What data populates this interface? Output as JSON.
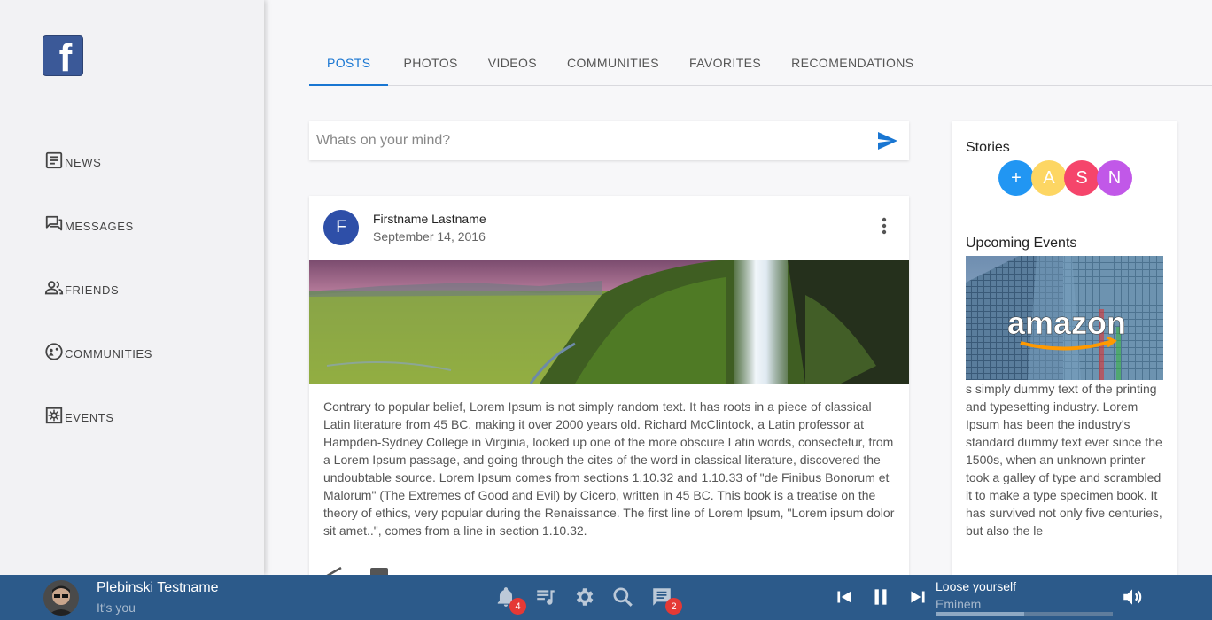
{
  "sidebar": {
    "logo": "f",
    "items": [
      {
        "label": "NEWS",
        "icon": "news-icon"
      },
      {
        "label": "MESSAGES",
        "icon": "messages-icon"
      },
      {
        "label": "FRIENDS",
        "icon": "friends-icon"
      },
      {
        "label": "COMMUNITIES",
        "icon": "communities-icon"
      },
      {
        "label": "EVENTS",
        "icon": "events-icon"
      }
    ]
  },
  "tabs": [
    "POSTS",
    "PHOTOS",
    "VIDEOS",
    "COMMUNITIES",
    "FAVORITES",
    "RECOMENDATIONS"
  ],
  "composer": {
    "placeholder": "Whats on your mind?"
  },
  "post": {
    "avatar_letter": "F",
    "author": "Firstname Lastname",
    "date": "September 14, 2016",
    "text": "Contrary to popular belief, Lorem Ipsum is not simply random text. It has roots in a piece of classical Latin literature from 45 BC, making it over 2000 years old. Richard McClintock, a Latin professor at Hampden-Sydney College in Virginia, looked up one of the more obscure Latin words, consectetur, from a Lorem Ipsum passage, and going through the cites of the word in classical literature, discovered the undoubtable source. Lorem Ipsum comes from sections 1.10.32 and 1.10.33 of \"de Finibus Bonorum et Malorum\" (The Extremes of Good and Evil) by Cicero, written in 45 BC. This book is a treatise on the theory of ethics, very popular during the Renaissance. The first line of Lorem Ipsum, \"Lorem ipsum dolor sit amet..\", comes from a line in section 1.10.32."
  },
  "right_panel": {
    "stories_title": "Stories",
    "stories": [
      {
        "letter": "+",
        "color": "#2196f3"
      },
      {
        "letter": "A",
        "color": "#fdd663"
      },
      {
        "letter": "S",
        "color": "#f5456b"
      },
      {
        "letter": "N",
        "color": "#c158e8"
      }
    ],
    "events_title": "Upcoming Events",
    "event_logo": "amazon",
    "event_text": "s simply dummy text of the printing and typesetting industry. Lorem Ipsum has been the industry's standard dummy text ever since the 1500s, when an unknown printer took a galley of type and scrambled it to make a type specimen book. It has survived not only five centuries, but also the le"
  },
  "bottom_bar": {
    "user_name": "Plebinski Testname",
    "user_status": "It's you",
    "notifications_count": "4",
    "messages_count": "2",
    "song_title": "Loose yourself",
    "song_artist": "Eminem",
    "song_progress": 0.5
  },
  "colors": {
    "accent": "#1976d2",
    "bottom_bar": "#2c5a8a",
    "logo": "#3b5998",
    "badge": "#e53935"
  }
}
